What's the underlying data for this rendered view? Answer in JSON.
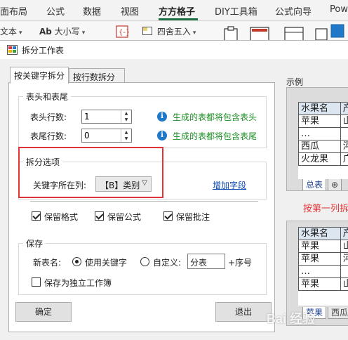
{
  "ribbon": {
    "tabs": [
      "面布局",
      "公式",
      "数据",
      "视图",
      "方方格子",
      "DIY工具箱",
      "公式向导",
      "Pow"
    ],
    "active_tab": "方方格子",
    "tools": {
      "text_dropdown": "文本",
      "case_dropdown": "大小写",
      "case_icon": "Ab",
      "round_dropdown": "四舍五入"
    }
  },
  "dialog": {
    "title": "拆分工作表",
    "tabs": [
      "按关键字拆分",
      "按行数拆分"
    ],
    "header_footer": {
      "group_title": "表头和表尾",
      "header_rows_label": "表头行数:",
      "header_rows_value": "1",
      "header_hint": "生成的表都将包含表头",
      "footer_rows_label": "表尾行数:",
      "footer_rows_value": "0",
      "footer_hint": "生成的表都将包含表尾"
    },
    "split_options": {
      "group_title": "拆分选项",
      "key_column_label": "关键字所在列:",
      "key_column_value": "【B】类别",
      "add_field_link": "增加字段"
    },
    "keep": {
      "format": "保留格式",
      "formula": "保留公式",
      "comment": "保留批注"
    },
    "save": {
      "group_title": "保存",
      "new_name_label": "新表名:",
      "use_key_option": "使用关键字",
      "custom_option": "自定义:",
      "custom_value": "分表",
      "suffix": "+序号",
      "separate_workbook": "保存为独立工作簿"
    },
    "buttons": {
      "ok": "确定",
      "exit": "退出"
    }
  },
  "example": {
    "label": "示例",
    "split_caption": "按第一列拆",
    "table_before": {
      "header": [
        "水果名",
        "产"
      ],
      "rows": [
        [
          "苹果",
          "山"
        ],
        [
          "…",
          ""
        ],
        [
          "西瓜",
          "河"
        ],
        [
          "火龙果",
          "广"
        ]
      ],
      "tabs": [
        "总表"
      ]
    },
    "table_after": {
      "header": [
        "水果名",
        "产"
      ],
      "rows": [
        [
          "苹果",
          "山"
        ],
        [
          "苹果",
          "河"
        ],
        [
          "…",
          ""
        ],
        [
          "苹果",
          "山"
        ]
      ],
      "tabs": [
        "苹果",
        "西瓜"
      ]
    }
  },
  "watermark": "Bai 经验",
  "colors": {
    "hint_green": "#1d8f26",
    "highlight_red": "#e0343a",
    "link_blue": "#0645ad",
    "active_tab_green": "#1e7145"
  }
}
